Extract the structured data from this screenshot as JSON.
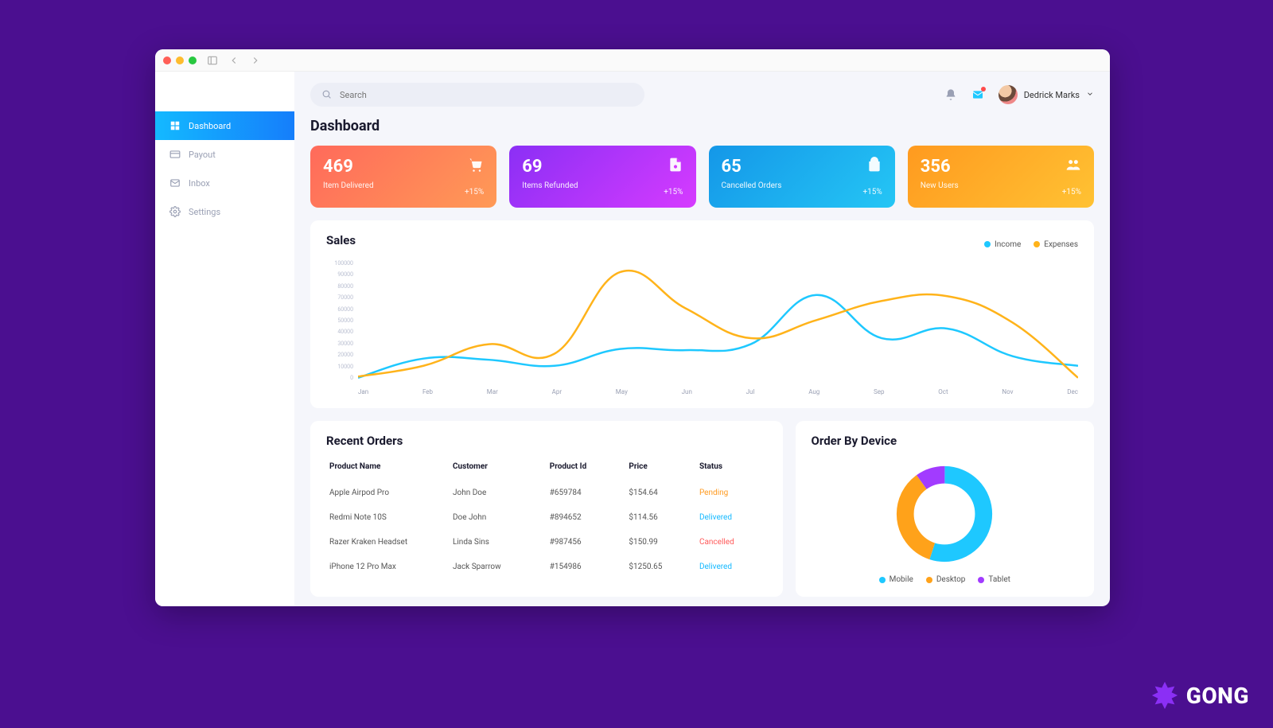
{
  "brand_logo_text": "GONG",
  "window": {
    "title": ""
  },
  "search": {
    "placeholder": "Search"
  },
  "user": {
    "name": "Dedrick Marks"
  },
  "sidebar": {
    "items": [
      {
        "label": "Dashboard",
        "icon": "grid-icon",
        "active": true
      },
      {
        "label": "Payout",
        "icon": "card-icon",
        "active": false
      },
      {
        "label": "Inbox",
        "icon": "mail-icon",
        "active": false
      },
      {
        "label": "Settings",
        "icon": "gear-icon",
        "active": false
      }
    ]
  },
  "page": {
    "title": "Dashboard"
  },
  "stats": [
    {
      "value": "469",
      "label": "Item Delivered",
      "pct": "+15%",
      "icon": "cart-icon"
    },
    {
      "value": "69",
      "label": "Items Refunded",
      "pct": "+15%",
      "icon": "file-icon"
    },
    {
      "value": "65",
      "label": "Cancelled Orders",
      "pct": "+15%",
      "icon": "bag-icon"
    },
    {
      "value": "356",
      "label": "New Users",
      "pct": "+15%",
      "icon": "users-icon"
    }
  ],
  "sales": {
    "title": "Sales",
    "legend": {
      "income": "Income",
      "expenses": "Expenses"
    },
    "colors": {
      "income": "#1ec8ff",
      "expenses": "#ffb31a"
    }
  },
  "chart_data": {
    "type": "line",
    "title": "Sales",
    "xlabel": "",
    "ylabel": "",
    "ylim": [
      0,
      100000
    ],
    "y_ticks": [
      100000,
      90000,
      80000,
      70000,
      60000,
      50000,
      40000,
      30000,
      20000,
      10000,
      0
    ],
    "categories": [
      "Jan",
      "Feb",
      "Mar",
      "Apr",
      "May",
      "Jun",
      "Jul",
      "Aug",
      "Sep",
      "Oct",
      "Nov",
      "Dec"
    ],
    "series": [
      {
        "name": "Income",
        "color": "#1ec8ff",
        "values": [
          2000,
          18000,
          17000,
          12000,
          26000,
          25000,
          30000,
          71000,
          35000,
          43000,
          20000,
          12000
        ]
      },
      {
        "name": "Expenses",
        "color": "#ffb31a",
        "values": [
          3000,
          12000,
          30000,
          22000,
          90000,
          60000,
          35000,
          50000,
          66000,
          70000,
          48000,
          2000
        ]
      }
    ]
  },
  "orders": {
    "title": "Recent Orders",
    "columns": [
      "Product Name",
      "Customer",
      "Product Id",
      "Price",
      "Status"
    ],
    "rows": [
      {
        "product": "Apple Airpod Pro",
        "customer": "John Doe",
        "id": "#659784",
        "price": "$154.64",
        "status": "Pending"
      },
      {
        "product": "Redmi Note 10S",
        "customer": "Doe John",
        "id": "#894652",
        "price": "$114.56",
        "status": "Delivered"
      },
      {
        "product": "Razer Kraken Headset",
        "customer": "Linda Sins",
        "id": "#987456",
        "price": "$150.99",
        "status": "Cancelled"
      },
      {
        "product": "iPhone 12 Pro Max",
        "customer": "Jack Sparrow",
        "id": "#154986",
        "price": "$1250.65",
        "status": "Delivered"
      }
    ]
  },
  "device": {
    "title": "Order By Device",
    "legend": [
      {
        "label": "Mobile",
        "color": "#1ec8ff",
        "value": 55
      },
      {
        "label": "Desktop",
        "color": "#ffa21a",
        "value": 35
      },
      {
        "label": "Tablet",
        "color": "#a23bff",
        "value": 10
      }
    ]
  }
}
